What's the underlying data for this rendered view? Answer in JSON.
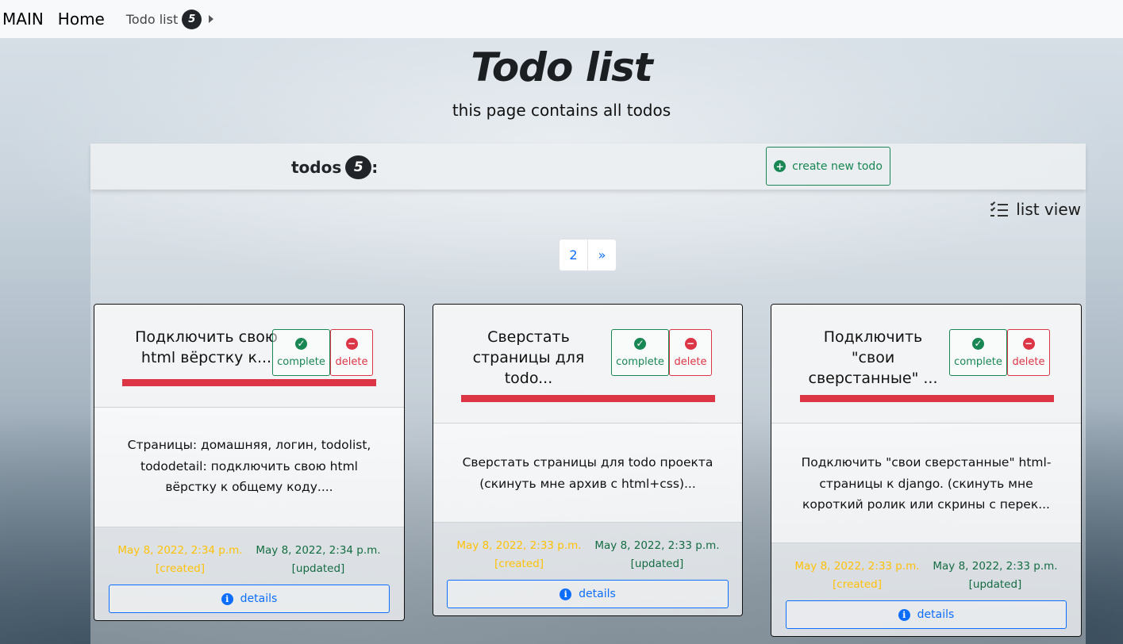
{
  "navbar": {
    "brand": "MAIN",
    "home": "Home",
    "todo_list": "Todo list",
    "todo_count": "5"
  },
  "header": {
    "title": "Todo list",
    "subtitle": "this page contains all todos"
  },
  "panel": {
    "todos_label": "todos",
    "todos_count": "5",
    "todos_colon": ":",
    "create_button": "create new todo",
    "list_view": "list view",
    "pagination": [
      "2",
      "»"
    ]
  },
  "cards": [
    {
      "title_lines": [
        "Подключить свою",
        "html вёрстку к..."
      ],
      "complete": "complete",
      "delete": "delete",
      "text_lines": [
        "Страницы: домашняя, логин, todolist,",
        "tododetail: подключить свою html",
        "вёрстку к общему коду...."
      ],
      "created_date": "May 8, 2022, 2:34 p.m.",
      "created_label": "[created]",
      "updated_date": "May 8, 2022, 2:34 p.m.",
      "updated_label": "[updated]",
      "details": "details"
    },
    {
      "title_lines": [
        "Сверстать",
        "страницы для",
        "todo..."
      ],
      "complete": "complete",
      "delete": "delete",
      "text_lines": [
        "Сверстать страницы для todo проекта",
        "(скинуть мне архив с html+css)..."
      ],
      "created_date": "May 8, 2022, 2:33 p.m.",
      "created_label": "[created]",
      "updated_date": "May 8, 2022, 2:33 p.m.",
      "updated_label": "[updated]",
      "details": "details"
    },
    {
      "title_lines": [
        "Подключить",
        "\"свои",
        "сверстанные\" ..."
      ],
      "complete": "complete",
      "delete": "delete",
      "text_lines": [
        "Подключить \"свои сверстанные\" html-",
        "страницы к django. (скинуть мне",
        "короткий ролик или скрины с перек..."
      ],
      "created_date": "May 8, 2022, 2:33 p.m.",
      "created_label": "[created]",
      "updated_date": "May 8, 2022, 2:33 p.m.",
      "updated_label": "[updated]",
      "details": "details"
    }
  ],
  "colors": {
    "success": "#198754",
    "danger": "#dc3545",
    "warning": "#ffc107",
    "primary": "#0d6efd",
    "dark": "#212529"
  },
  "icons": {
    "create": "plus-circle-icon",
    "complete": "check-circle-icon",
    "delete": "minus-circle-icon",
    "details": "info-circle-icon",
    "list_view": "list-check-icon",
    "breadcrumb": "caret-right-icon"
  }
}
